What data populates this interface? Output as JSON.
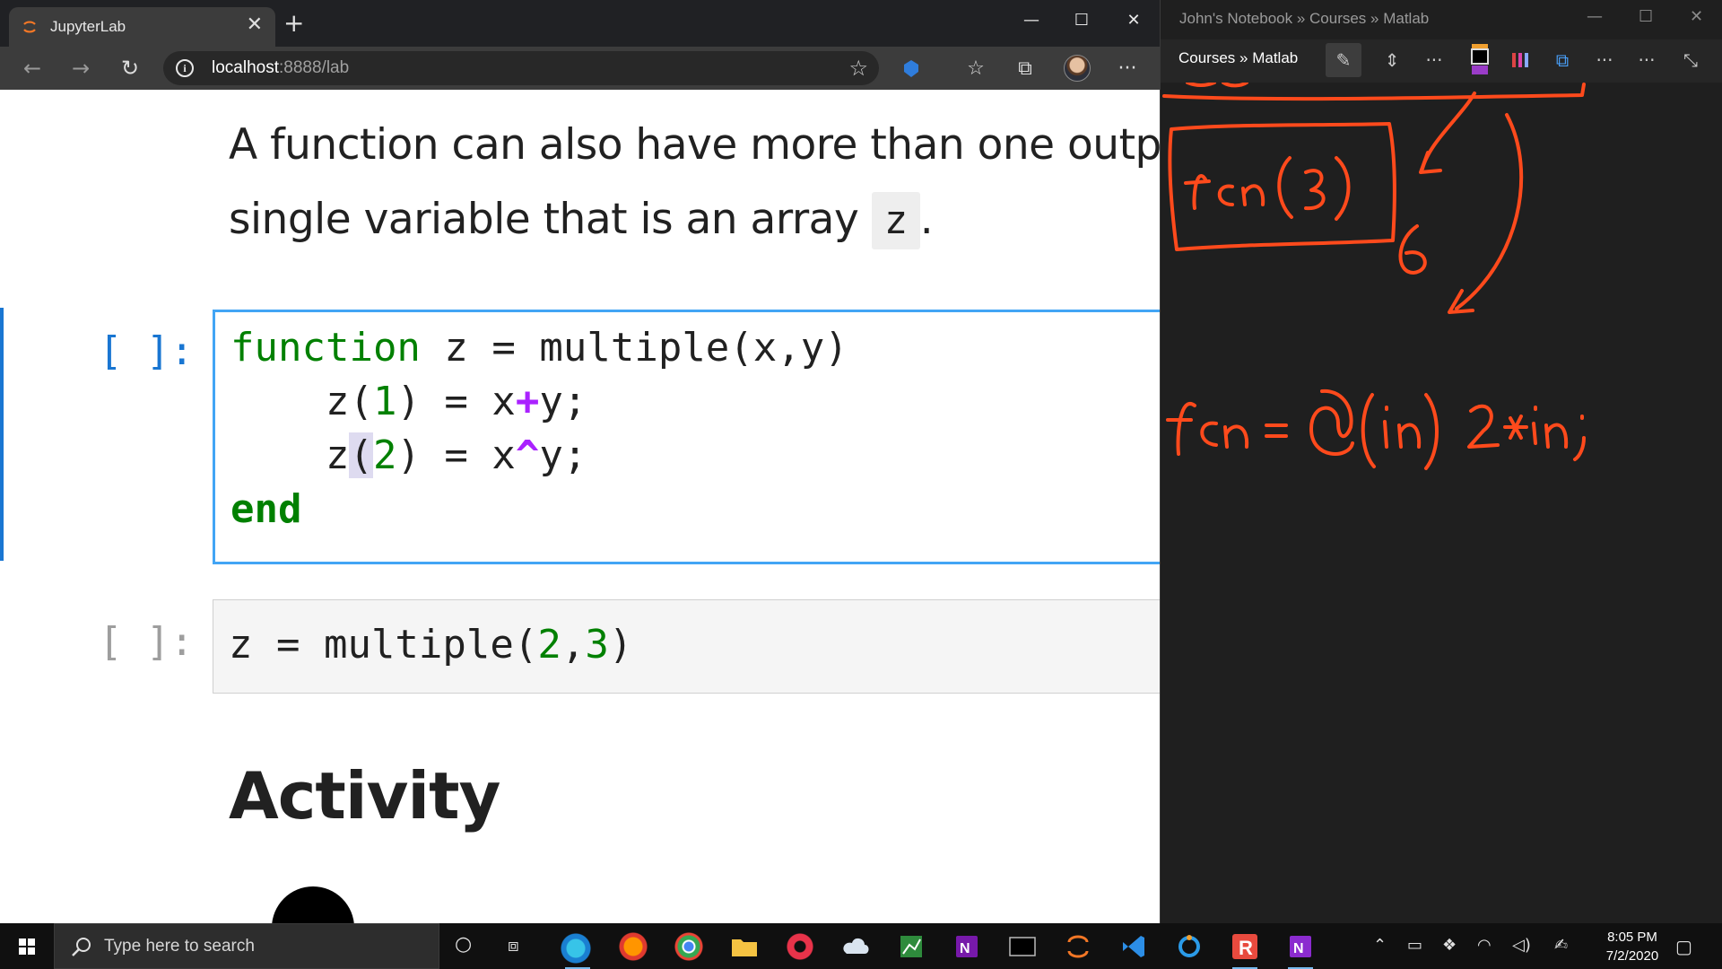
{
  "browser": {
    "tab_title": "JupyterLab",
    "tab_close": "✕",
    "new_tab": "+",
    "window_controls": {
      "minimize": "—",
      "maximize": "☐",
      "close": "✕"
    },
    "url_host": "localhost",
    "url_rest": ":8888/lab"
  },
  "notebook": {
    "markdown_line1": "A function can also have more than one output",
    "markdown_line2_prefix": "single variable that is an array ",
    "markdown_inline_code": "z",
    "markdown_line2_suffix": ".",
    "cell1": {
      "prompt": "[ ]:",
      "lines": [
        "function z = multiple(x,y)",
        "    z(1) = x+y;",
        "    z(2) = x^y;",
        "end"
      ]
    },
    "cell2": {
      "prompt": "[ ]:",
      "code": "z = multiple(2,3)"
    },
    "heading": "Activity"
  },
  "onenote": {
    "window_title": "John's Notebook » Courses » Matlab",
    "breadcrumb": "Courses » Matlab",
    "ink_text": [
      "fcn (3)",
      "6",
      "fcn = @(in) 2*in;"
    ],
    "ink_color": "#ff4a1c"
  },
  "taskbar": {
    "search_placeholder": "Type here to search",
    "clock_time": "8:05 PM",
    "clock_date": "7/2/2020"
  },
  "colors": {
    "jupyter_accent": "#1976d2",
    "keyword_green": "#008000",
    "operator_purple": "#aa22ff"
  }
}
